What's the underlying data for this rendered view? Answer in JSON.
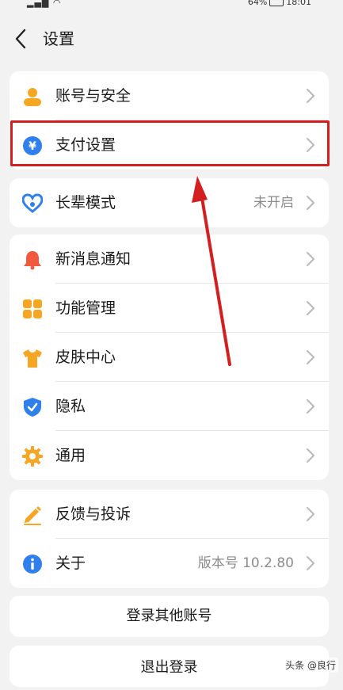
{
  "status": {
    "battery": "64%",
    "time": "18:01"
  },
  "header": {
    "title": "设置"
  },
  "group1": {
    "account": "账号与安全",
    "payment": "支付设置"
  },
  "group2": {
    "elder_mode": "长辈模式",
    "elder_mode_value": "未开启"
  },
  "group3": {
    "notifications": "新消息通知",
    "features": "功能管理",
    "skin": "皮肤中心",
    "privacy": "隐私",
    "general": "通用"
  },
  "group4": {
    "feedback": "反馈与投诉",
    "about": "关于",
    "about_value": "版本号 10.2.80"
  },
  "buttons": {
    "login_other": "登录其他账号",
    "logout": "退出登录"
  },
  "watermark": "头条 @良行",
  "colors": {
    "background": "#f2f2f2",
    "card": "#ffffff",
    "orange": "#f5a623",
    "blue": "#2f80ed",
    "red_annotation": "#d31f1f",
    "bell_red": "#f2583e"
  }
}
